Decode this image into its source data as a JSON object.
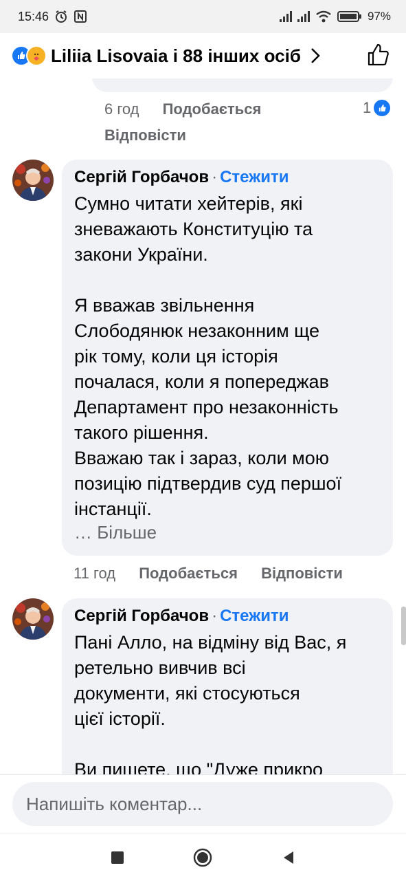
{
  "status_bar": {
    "time": "15:46",
    "battery": "97%"
  },
  "header": {
    "title": "Liliia Lisovaia і 88 інших осіб",
    "icons": [
      "like-reaction-icon",
      "care-reaction-icon",
      "chevron-right-icon",
      "thumbs-up-icon"
    ]
  },
  "prev_comment": {
    "time": "6 год",
    "like_label": "Подобається",
    "reply_label": "Відповісти",
    "reaction_count": "1"
  },
  "comments": [
    {
      "author": "Сергій Горбачов",
      "separator": "·",
      "follow_label": "Стежити",
      "text": "Сумно читати хейтерів, які\nзневажають Конституцію та\nзакони України.\n\nЯ вважав звільнення\nСлободянюк незаконним ще\nрік тому, коли ця історія\nпочалася, коли я попереджав\nДепартамент про незаконність\nтакого рішення.\nВважаю так і зараз, коли мою\nпозицію підтвердив суд першої\nінстанції.",
      "more_label": "… Більше",
      "time": "11 год",
      "like_label": "Подобається",
      "reply_label": "Відповісти"
    },
    {
      "author": "Сергій Горбачов",
      "separator": "·",
      "follow_label": "Стежити",
      "text": "Пані Алло, на відміну від Вас, я\nретельно вивчив всі\nдокументи, які стосуються\nцієї історії.\n\nВи пишете, що \"Дуже прикро"
    }
  ],
  "composer": {
    "placeholder": "Напишіть коментар..."
  },
  "colors": {
    "accent": "#1877f2",
    "bubble": "#f0f2f5",
    "secondary_text": "#65676b"
  }
}
